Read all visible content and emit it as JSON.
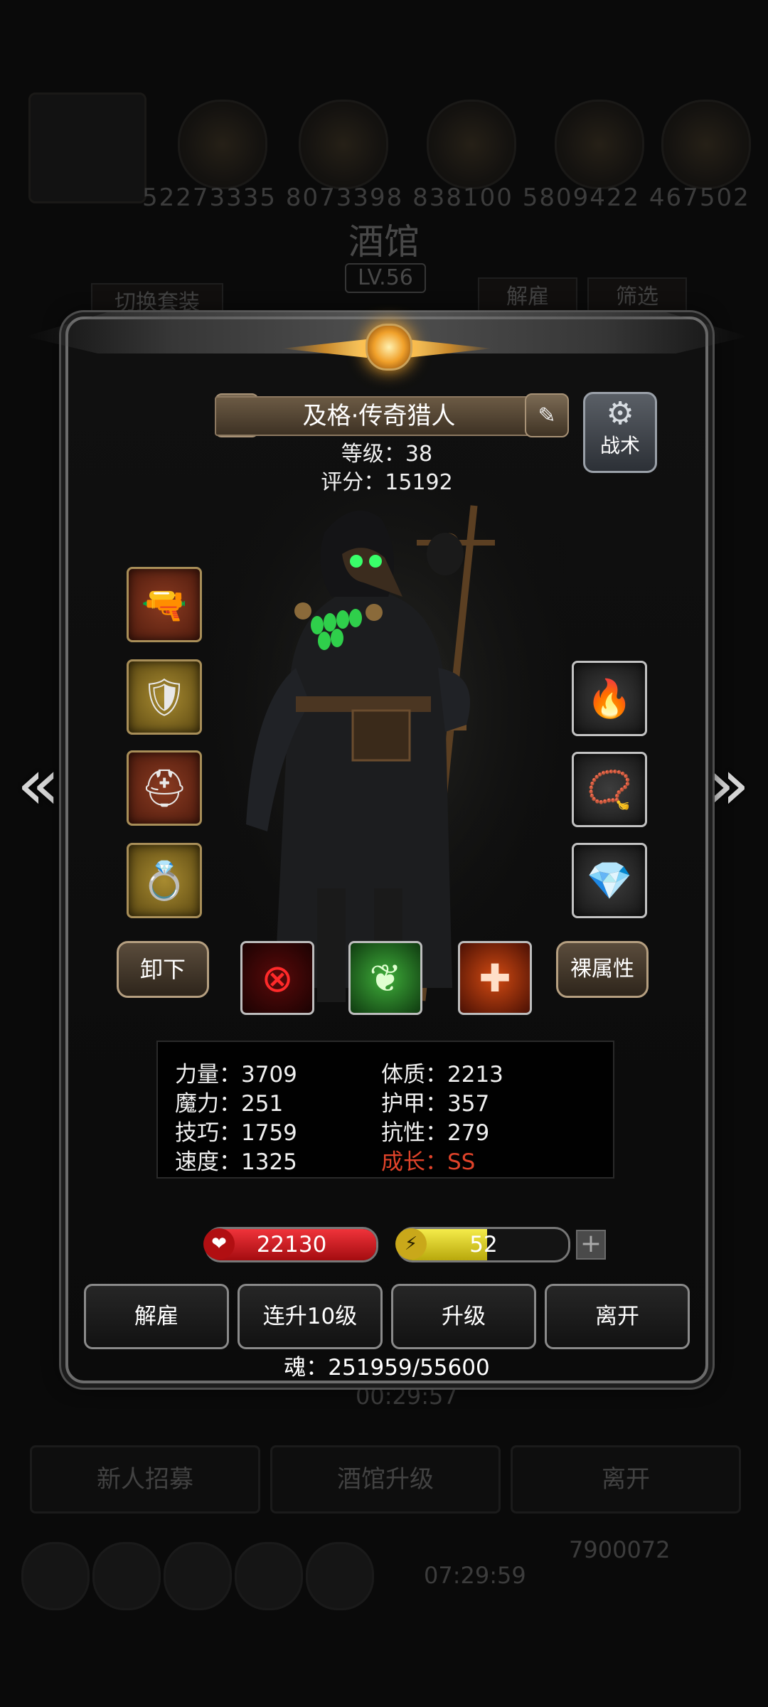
{
  "background": {
    "resource_numbers": "52273335  8073398  838100  5809422  467502",
    "title": "酒馆",
    "level": "LV.56",
    "switch_outfit": "切换套装",
    "dismiss": "解雇",
    "filter": "筛选",
    "timer_main": "00:29:57",
    "recruit": "新人招募",
    "tavern_upgrade": "酒馆升级",
    "leave": "离开",
    "gold_amount": "7900072",
    "timer_chest": "07:29:59"
  },
  "hero": {
    "name": "及格·传奇猎人",
    "level_text": "等级：38",
    "score_text": "评分：15192",
    "tactic_label": "战术"
  },
  "buttons": {
    "unequip": "卸下",
    "naked_stats": "裸属性",
    "dismiss": "解雇",
    "upgrade10": "连升10级",
    "upgrade": "升级",
    "leave": "离开"
  },
  "stats": {
    "strength": "力量：3709",
    "magic": "魔力：251",
    "skill": "技巧：1759",
    "speed": "速度：1325",
    "constitution": "体质：2213",
    "armor": "护甲：357",
    "resistance": "抗性：279",
    "growth": "成长：SS"
  },
  "bars": {
    "hp": "22130",
    "hp_fill": 1.0,
    "energy": "52",
    "energy_fill": 0.52
  },
  "soul_text": "魂：251959/55600",
  "icons": {
    "prev": "double-chevron-left-icon",
    "next": "double-chevron-right-icon",
    "weapon": "musket-icon",
    "armor": "chest-armor-icon",
    "helmet": "helmet-icon",
    "ring": "ring-icon",
    "fire": "fire-orb-icon",
    "amulet": "amulet-icon",
    "gem": "blue-gem-icon"
  },
  "colors": {
    "hp": "#d4141a",
    "energy": "#e2d81a",
    "growth": "#e0432a",
    "gold_accent": "#f0a02a"
  }
}
